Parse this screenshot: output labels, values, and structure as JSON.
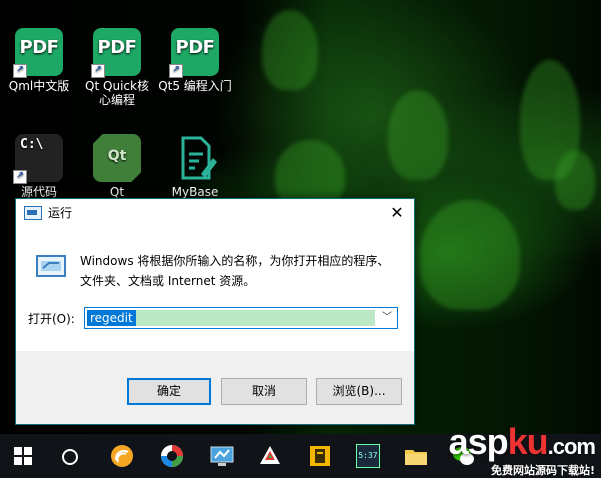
{
  "desktop": {
    "icons": [
      {
        "label_lines": [
          "Qml中文版"
        ],
        "badge": "PDF"
      },
      {
        "label_lines": [
          "Qt Quick核",
          "心编程"
        ],
        "badge": "PDF"
      },
      {
        "label_lines": [
          "Qt5 编程入门"
        ],
        "badge": "PDF"
      },
      {
        "label_lines": [
          "源代码"
        ],
        "badge": "C:\\"
      },
      {
        "label_lines": [
          "Qt"
        ],
        "badge": "Qt"
      },
      {
        "label_lines": [
          "MyBase"
        ],
        "badge": ""
      }
    ],
    "shortcut_glyph": "↗"
  },
  "run_dialog": {
    "title": "运行",
    "close_glyph": "✕",
    "description": "Windows 将根据你所输入的名称，为你打开相应的程序、文件夹、文档或 Internet 资源。",
    "open_label": "打开(O):",
    "input_value": "regedit",
    "dropdown_glyph": "﹀",
    "buttons": {
      "ok": "确定",
      "cancel": "取消",
      "browse": "浏览(B)..."
    }
  },
  "taskbar": {
    "clock_app_text": "5:37"
  },
  "watermark": {
    "brand_a": "asp",
    "brand_b": "ku",
    "brand_c": ".com",
    "slogan": "免费网站源码下载站!"
  },
  "colors": {
    "accent": "#0078d7",
    "pdf_green": "#1ea866",
    "dialog_border": "#0f6e7a",
    "selection_highlight": "#bde8c6"
  }
}
